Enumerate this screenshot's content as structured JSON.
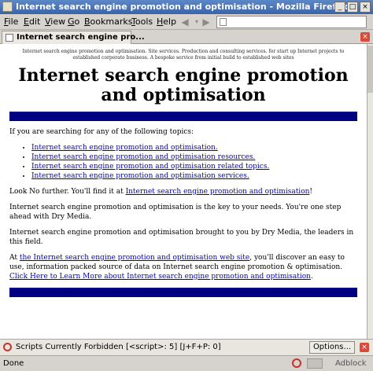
{
  "window": {
    "title": "Internet search engine promotion and optimisation - Mozilla Firefox"
  },
  "menubar": {
    "items": [
      {
        "pre": "",
        "u": "F",
        "post": "ile"
      },
      {
        "pre": "",
        "u": "E",
        "post": "dit"
      },
      {
        "pre": "",
        "u": "V",
        "post": "iew"
      },
      {
        "pre": "",
        "u": "G",
        "post": "o"
      },
      {
        "pre": "",
        "u": "B",
        "post": "ookmarks"
      },
      {
        "pre": "",
        "u": "T",
        "post": "ools"
      },
      {
        "pre": "",
        "u": "H",
        "post": "elp"
      }
    ]
  },
  "tabs": [
    {
      "label": "Internet search engine pro..."
    }
  ],
  "page": {
    "small_header": "Internet search engine promotion and optimisation. Site services. Production and consulting services. for start up Internet projects to established corporate business. A bespoke service from initial build to established web sites",
    "heading": "Internet search engine promotion and optimisation",
    "intro": "If you are searching for any of the following topics:",
    "topics": [
      "Internet search engine promotion and optimisation.",
      "Internet search engine promotion and optimisation resources.",
      "Internet search engine promotion and optimisation related topics.",
      "Internet search engine promotion and optimisation services."
    ],
    "look_prefix": "Look No further. You'll find it at ",
    "look_link": "Internet search engine promotion and optimisation",
    "look_suffix": "!",
    "para1": "Internet search engine promotion and optimisation is the key to your needs. You're one step ahead with Dry Media.",
    "para2": "Internet search engine promotion and optimisation brought to you by Dry Media, the leaders in this field.",
    "at_prefix": "At ",
    "at_link": "the Internet search engine promotion and optimisation web site",
    "at_suffix": ", you'll discover an easy to use, information packed source of data on Internet search engine promotion & optimisation.",
    "learn_link": "Click Here to Learn More about Internet search engine promotion and optimisation",
    "learn_suffix": "."
  },
  "scriptbar": {
    "text": "Scripts Currently Forbidden [<script>: 5] [J+F+P: 0]",
    "options_label": "Options..."
  },
  "status": {
    "text": "Done",
    "adblock": "Adblock"
  }
}
